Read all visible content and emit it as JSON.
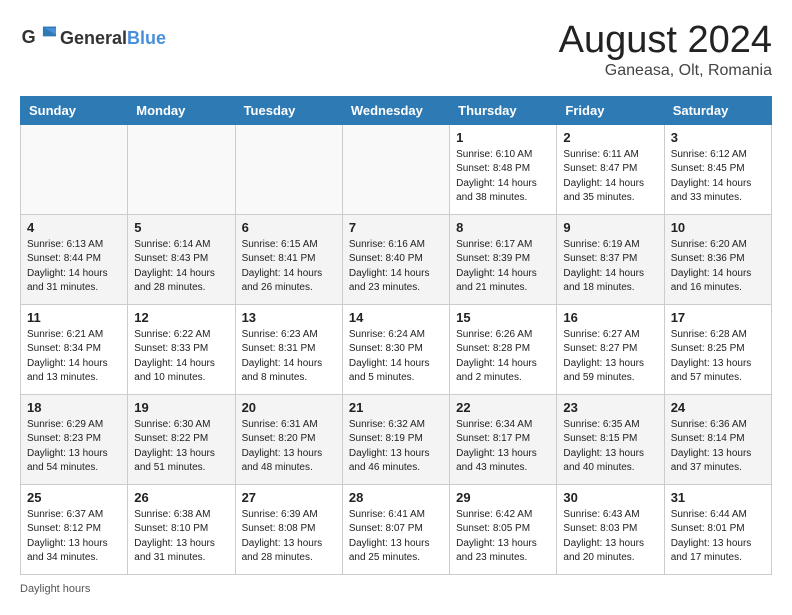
{
  "header": {
    "logo_general": "General",
    "logo_blue": "Blue",
    "month_year": "August 2024",
    "location": "Ganeasa, Olt, Romania"
  },
  "calendar": {
    "days_of_week": [
      "Sunday",
      "Monday",
      "Tuesday",
      "Wednesday",
      "Thursday",
      "Friday",
      "Saturday"
    ],
    "weeks": [
      [
        {
          "day": "",
          "info": ""
        },
        {
          "day": "",
          "info": ""
        },
        {
          "day": "",
          "info": ""
        },
        {
          "day": "",
          "info": ""
        },
        {
          "day": "1",
          "info": "Sunrise: 6:10 AM\nSunset: 8:48 PM\nDaylight: 14 hours and 38 minutes."
        },
        {
          "day": "2",
          "info": "Sunrise: 6:11 AM\nSunset: 8:47 PM\nDaylight: 14 hours and 35 minutes."
        },
        {
          "day": "3",
          "info": "Sunrise: 6:12 AM\nSunset: 8:45 PM\nDaylight: 14 hours and 33 minutes."
        }
      ],
      [
        {
          "day": "4",
          "info": "Sunrise: 6:13 AM\nSunset: 8:44 PM\nDaylight: 14 hours and 31 minutes."
        },
        {
          "day": "5",
          "info": "Sunrise: 6:14 AM\nSunset: 8:43 PM\nDaylight: 14 hours and 28 minutes."
        },
        {
          "day": "6",
          "info": "Sunrise: 6:15 AM\nSunset: 8:41 PM\nDaylight: 14 hours and 26 minutes."
        },
        {
          "day": "7",
          "info": "Sunrise: 6:16 AM\nSunset: 8:40 PM\nDaylight: 14 hours and 23 minutes."
        },
        {
          "day": "8",
          "info": "Sunrise: 6:17 AM\nSunset: 8:39 PM\nDaylight: 14 hours and 21 minutes."
        },
        {
          "day": "9",
          "info": "Sunrise: 6:19 AM\nSunset: 8:37 PM\nDaylight: 14 hours and 18 minutes."
        },
        {
          "day": "10",
          "info": "Sunrise: 6:20 AM\nSunset: 8:36 PM\nDaylight: 14 hours and 16 minutes."
        }
      ],
      [
        {
          "day": "11",
          "info": "Sunrise: 6:21 AM\nSunset: 8:34 PM\nDaylight: 14 hours and 13 minutes."
        },
        {
          "day": "12",
          "info": "Sunrise: 6:22 AM\nSunset: 8:33 PM\nDaylight: 14 hours and 10 minutes."
        },
        {
          "day": "13",
          "info": "Sunrise: 6:23 AM\nSunset: 8:31 PM\nDaylight: 14 hours and 8 minutes."
        },
        {
          "day": "14",
          "info": "Sunrise: 6:24 AM\nSunset: 8:30 PM\nDaylight: 14 hours and 5 minutes."
        },
        {
          "day": "15",
          "info": "Sunrise: 6:26 AM\nSunset: 8:28 PM\nDaylight: 14 hours and 2 minutes."
        },
        {
          "day": "16",
          "info": "Sunrise: 6:27 AM\nSunset: 8:27 PM\nDaylight: 13 hours and 59 minutes."
        },
        {
          "day": "17",
          "info": "Sunrise: 6:28 AM\nSunset: 8:25 PM\nDaylight: 13 hours and 57 minutes."
        }
      ],
      [
        {
          "day": "18",
          "info": "Sunrise: 6:29 AM\nSunset: 8:23 PM\nDaylight: 13 hours and 54 minutes."
        },
        {
          "day": "19",
          "info": "Sunrise: 6:30 AM\nSunset: 8:22 PM\nDaylight: 13 hours and 51 minutes."
        },
        {
          "day": "20",
          "info": "Sunrise: 6:31 AM\nSunset: 8:20 PM\nDaylight: 13 hours and 48 minutes."
        },
        {
          "day": "21",
          "info": "Sunrise: 6:32 AM\nSunset: 8:19 PM\nDaylight: 13 hours and 46 minutes."
        },
        {
          "day": "22",
          "info": "Sunrise: 6:34 AM\nSunset: 8:17 PM\nDaylight: 13 hours and 43 minutes."
        },
        {
          "day": "23",
          "info": "Sunrise: 6:35 AM\nSunset: 8:15 PM\nDaylight: 13 hours and 40 minutes."
        },
        {
          "day": "24",
          "info": "Sunrise: 6:36 AM\nSunset: 8:14 PM\nDaylight: 13 hours and 37 minutes."
        }
      ],
      [
        {
          "day": "25",
          "info": "Sunrise: 6:37 AM\nSunset: 8:12 PM\nDaylight: 13 hours and 34 minutes."
        },
        {
          "day": "26",
          "info": "Sunrise: 6:38 AM\nSunset: 8:10 PM\nDaylight: 13 hours and 31 minutes."
        },
        {
          "day": "27",
          "info": "Sunrise: 6:39 AM\nSunset: 8:08 PM\nDaylight: 13 hours and 28 minutes."
        },
        {
          "day": "28",
          "info": "Sunrise: 6:41 AM\nSunset: 8:07 PM\nDaylight: 13 hours and 25 minutes."
        },
        {
          "day": "29",
          "info": "Sunrise: 6:42 AM\nSunset: 8:05 PM\nDaylight: 13 hours and 23 minutes."
        },
        {
          "day": "30",
          "info": "Sunrise: 6:43 AM\nSunset: 8:03 PM\nDaylight: 13 hours and 20 minutes."
        },
        {
          "day": "31",
          "info": "Sunrise: 6:44 AM\nSunset: 8:01 PM\nDaylight: 13 hours and 17 minutes."
        }
      ]
    ],
    "footer_note": "Daylight hours"
  }
}
